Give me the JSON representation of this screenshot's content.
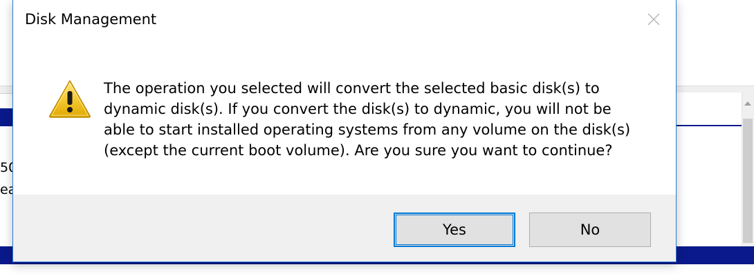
{
  "dialog": {
    "title": "Disk Management",
    "close_icon": "close-icon",
    "warning_icon": "warning-icon",
    "message_lines": [
      "The operation you selected will convert the selected basic disk(s) to",
      "dynamic disk(s). If you convert the disk(s) to dynamic, you will not be",
      "able to start installed operating systems from any volume on the disk(s)",
      "(except the current boot volume). Are you sure you want to continue?"
    ],
    "buttons": {
      "yes_label": "Yes",
      "no_label": "No"
    }
  },
  "background": {
    "fragment_1": "50",
    "fragment_2": "ea"
  },
  "colors": {
    "accent_blue": "#0078d7",
    "warning_yellow": "#f7c934",
    "background_strip": "#0a1a8c"
  }
}
